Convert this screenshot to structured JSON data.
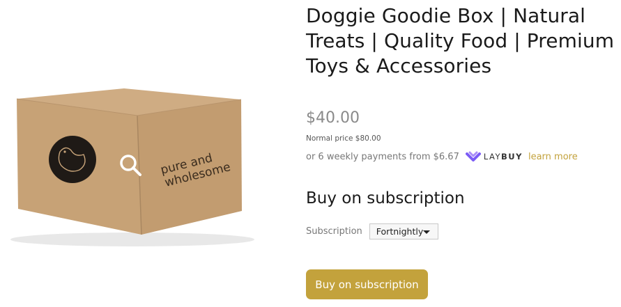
{
  "product": {
    "title": "Doggie Goodie Box | Natural Treats | Quality Food | Premium Toys & Accessories",
    "image_alt": "Pure and wholesome cardboard box with bird logo",
    "box_print": {
      "line1": "pure and",
      "line2": "wholesome"
    }
  },
  "pricing": {
    "price": "$40.00",
    "normal_price": "Normal price $80.00",
    "installments_text": "or 6 weekly payments from $6.67",
    "laybuy_brand_1": "LAY",
    "laybuy_brand_2": "BUY",
    "learn_more": "learn more"
  },
  "subscription": {
    "heading": "Buy on subscription",
    "label": "Subscription",
    "selected": "Fortnightly",
    "button": "Buy on subscription"
  },
  "icons": {
    "zoom": "magnifier-icon",
    "laybuy": "laybuy-heart-icon"
  },
  "colors": {
    "accent": "#c3a23c",
    "laybuy": "#7b5cf5",
    "box": "#c9a57a"
  }
}
